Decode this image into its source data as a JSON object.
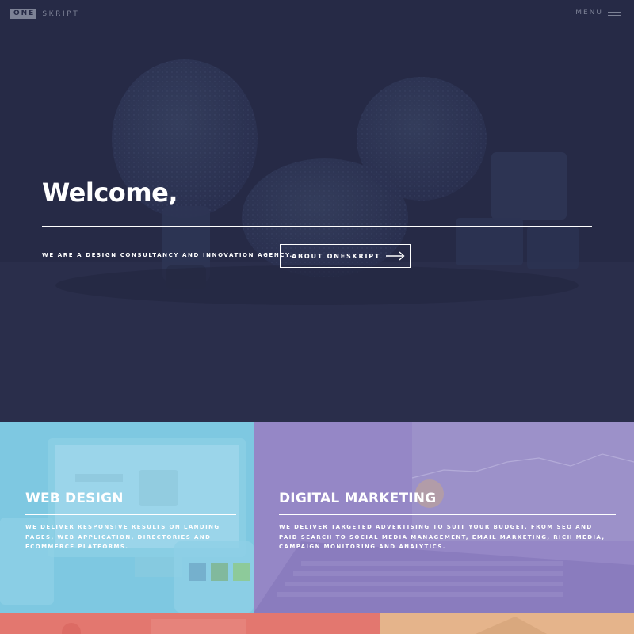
{
  "header": {
    "logo_box": "ONE",
    "logo_word": "SKRIPT",
    "menu_label": "MENU",
    "menu_icon": "hamburger-icon"
  },
  "hero": {
    "title": "Welcome,",
    "tagline": "WE ARE A DESIGN CONSULTANCY AND INNOVATION AGENCY.",
    "cta_label": "ABOUT ONESKRIPT",
    "cta_icon": "arrow-right-icon",
    "background": "light-bulbs-photo"
  },
  "services": [
    {
      "title": "WEB DESIGN",
      "description": "WE DELIVER RESPONSIVE RESULTS ON LANDING PAGES, WEB APPLICATION, DIRECTORIES AND ECOMMERCE PLATFORMS.",
      "color": "#7ec8e1",
      "background": "devices-photo"
    },
    {
      "title": "DIGITAL MARKETING",
      "description": "WE DELIVER TARGETED ADVERTISING TO SUIT YOUR BUDGET. FROM SEO AND PAID SEARCH TO SOCIAL MEDIA MANAGEMENT, EMAIL MARKETING, RICH MEDIA, CAMPAIGN MONITORING AND ANALYTICS.",
      "color": "#9587c6",
      "background": "laptop-photo"
    },
    {
      "color": "#e3776f"
    },
    {
      "color": "#e5b48b"
    }
  ],
  "colors": {
    "hero_bg": "#262a46",
    "nav_text": "#7d8296",
    "text": "#ffffff"
  }
}
